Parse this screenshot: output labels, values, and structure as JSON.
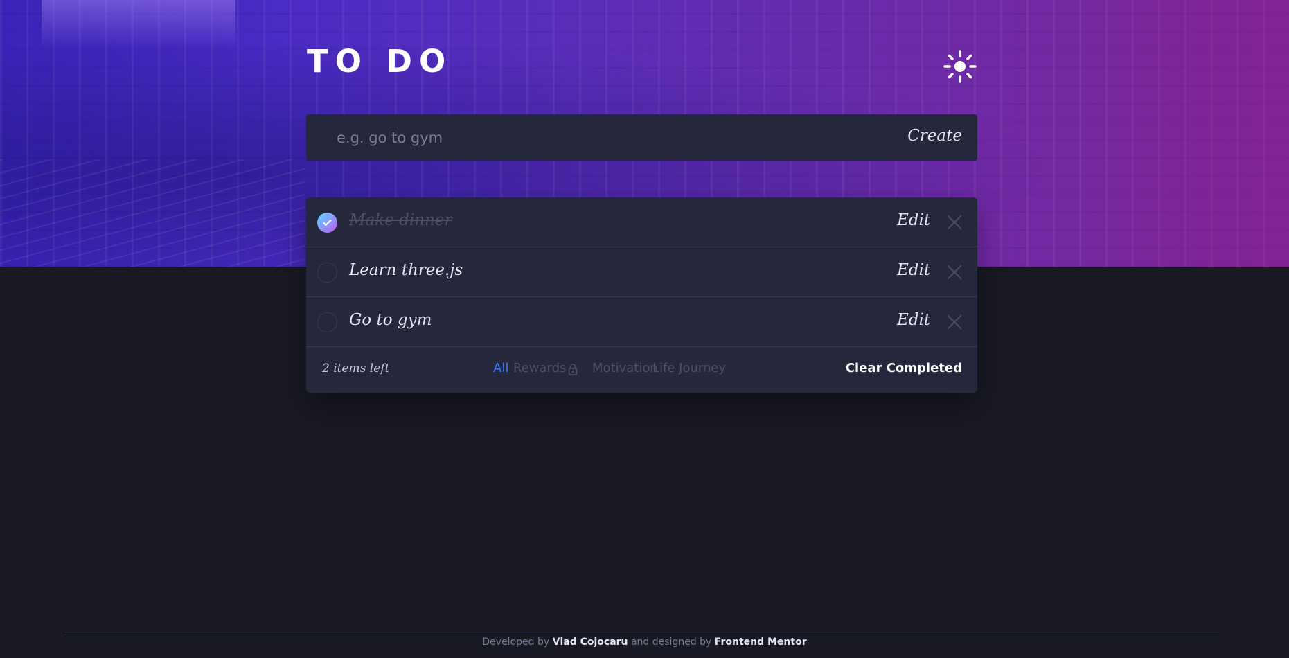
{
  "header": {
    "title": "TO DO",
    "theme_icon": "sun-icon"
  },
  "new_todo": {
    "placeholder": "e.g. go to gym",
    "value": "",
    "create_label": "Create"
  },
  "todos": [
    {
      "text": "Make dinner",
      "completed": true,
      "edit_label": "Edit",
      "delete_icon": "close-icon"
    },
    {
      "text": "Learn three.js",
      "completed": false,
      "edit_label": "Edit",
      "delete_icon": "close-icon"
    },
    {
      "text": "Go to gym",
      "completed": false,
      "edit_label": "Edit",
      "delete_icon": "close-icon"
    }
  ],
  "list_footer": {
    "items_left": "2 items left",
    "filters": [
      {
        "label": "All",
        "active": true,
        "locked": false
      },
      {
        "label": "Rewards",
        "active": false,
        "locked": true
      },
      {
        "label": "Motivation",
        "active": false,
        "locked": false
      },
      {
        "label": "Life Journey",
        "active": false,
        "locked": false
      }
    ],
    "clear_label": "Clear Completed"
  },
  "credits": {
    "prefix": "Developed by",
    "developer": "Vlad Cojocaru",
    "middle": "and designed by",
    "designer": "Frontend Mentor"
  },
  "colors": {
    "background": "#181923",
    "card": "#25273c",
    "accent": "#3a7cfd",
    "check_gradient_start": "#57ddff",
    "check_gradient_end": "#c058f3"
  }
}
